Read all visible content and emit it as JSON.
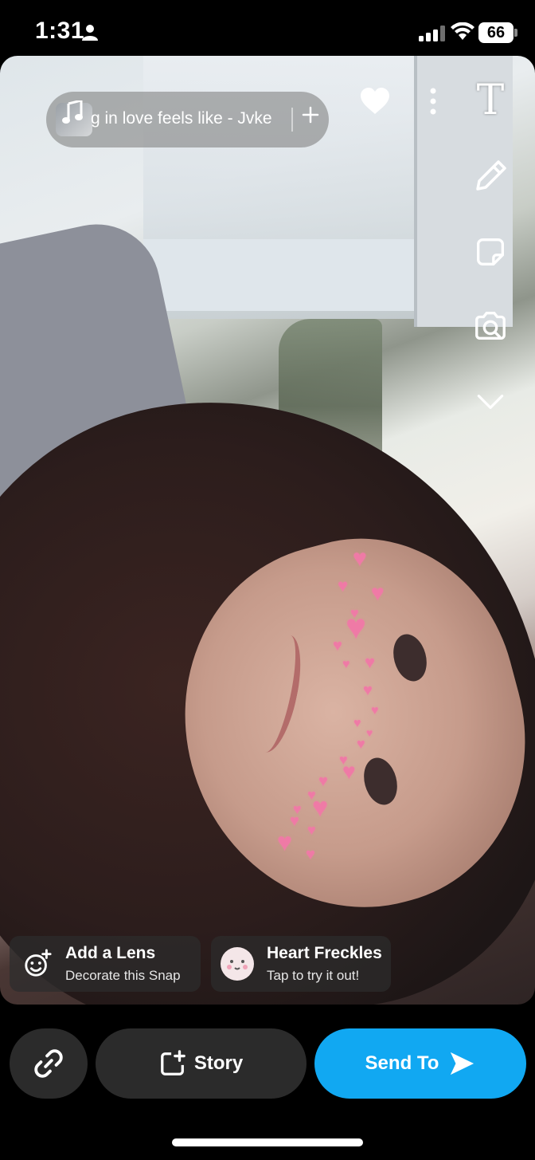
{
  "status_bar": {
    "time": "1:31",
    "battery_level": "66"
  },
  "music": {
    "song_text": "g in love feels like - Jvke"
  },
  "lens_chips": {
    "add_lens": {
      "title": "Add a Lens",
      "subtitle": "Decorate this Snap"
    },
    "heart_freckles": {
      "title": "Heart Freckles",
      "subtitle": "Tap to try it out!"
    }
  },
  "bottom_bar": {
    "story_label": "Story",
    "send_label": "Send To"
  },
  "tools": {
    "text_label": "T"
  },
  "colors": {
    "send_button": "#11a8f2",
    "button_dark": "#2b2b2b",
    "heart_freckles": "#ef7aa6"
  }
}
